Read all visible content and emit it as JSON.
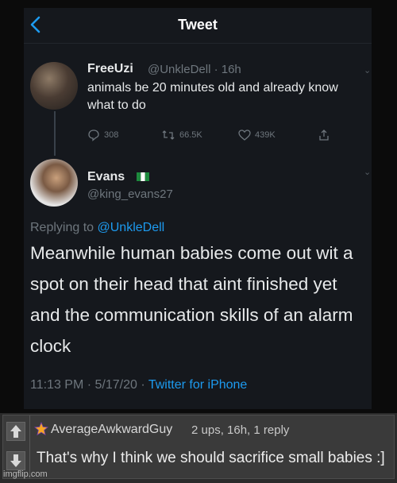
{
  "header": {
    "title": "Tweet"
  },
  "tweet1": {
    "name": "FreeUzi",
    "handle_time": "@UnkleDell · 16h",
    "text": "animals be 20 minutes old and already know what to do",
    "replies": "308",
    "retweets": "66.5K",
    "likes": "439K"
  },
  "tweet2": {
    "name": "Evans",
    "handle": "@king_evans27",
    "replying_prefix": "Replying to ",
    "replying_to": "@UnkleDell",
    "text": "Meanwhile human babies come out wit a spot on their head that aint finished yet and the communication skills of an alarm clock",
    "timestamp": "11:13 PM · 5/17/20 · ",
    "source": "Twitter for iPhone"
  },
  "comment": {
    "username": "AverageAwkwardGuy",
    "meta": "2 ups, 16h, 1 reply",
    "text": "That's why I think we should sacrifice small babies :]"
  },
  "watermark": "imgflip.com",
  "colors": {
    "link": "#1d9bf0",
    "background": "#15181d",
    "muted": "#6e767d"
  }
}
